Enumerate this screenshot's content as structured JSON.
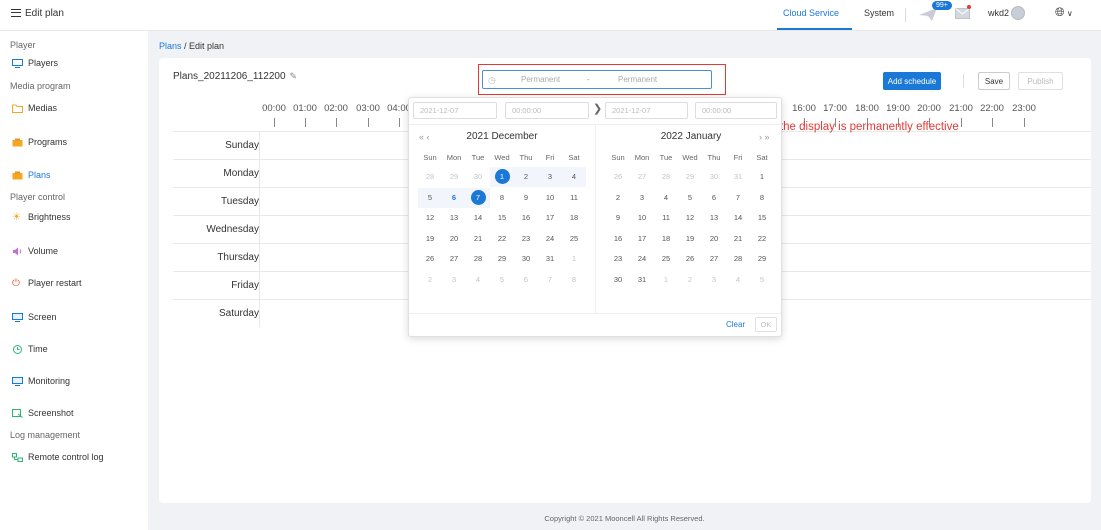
{
  "topbar": {
    "menu_label": "Edit plan",
    "nav": [
      "Cloud Service",
      "System"
    ],
    "badge": "99+",
    "user": "wkd2"
  },
  "sidebar": {
    "groups": [
      {
        "heading": "Player",
        "items": [
          "Players"
        ]
      },
      {
        "heading": "Media program",
        "items": [
          "Medias",
          "Programs",
          "Plans"
        ]
      },
      {
        "heading": "Player control",
        "items": [
          "Brightness",
          "Volume",
          "Player restart",
          "Screen",
          "Time",
          "Monitoring",
          "Screenshot"
        ]
      },
      {
        "heading": "Log management",
        "items": [
          "Remote control log"
        ]
      }
    ],
    "active": "Plans"
  },
  "breadcrumb": {
    "parent": "Plans",
    "separator": " / ",
    "current": "Edit plan"
  },
  "plan": {
    "name": "Plans_20211206_112200",
    "range_start_placeholder": "Permanent",
    "range_separator": "-",
    "range_end_placeholder": "Permanent",
    "add_schedule": "Add schedule",
    "save": "Save",
    "publish": "Publish"
  },
  "timeline": {
    "ticks": [
      "00:00",
      "01:00",
      "02:00",
      "03:00",
      "04:00",
      "16:00",
      "17:00",
      "18:00",
      "19:00",
      "20:00",
      "21:00",
      "22:00",
      "23:00"
    ],
    "days": [
      "Sunday",
      "Monday",
      "Tuesday",
      "Wednesday",
      "Thursday",
      "Friday",
      "Saturday"
    ]
  },
  "annotation": "Set the effective time to display the time filter box, if not set, the display is permanently effective",
  "picker": {
    "start_date": "2021-12-07",
    "start_time": "00:00:00",
    "end_date": "2021-12-07",
    "end_time": "00:00:00",
    "nav_prev": "«  ‹",
    "nav_next": "›  »",
    "left_title": "2021 December",
    "right_title": "2022 January",
    "weekdays": [
      "Sun",
      "Mon",
      "Tue",
      "Wed",
      "Thu",
      "Fri",
      "Sat"
    ],
    "left_days": [
      [
        "28",
        "29",
        "30",
        "1",
        "2",
        "3",
        "4"
      ],
      [
        "5",
        "6",
        "7",
        "8",
        "9",
        "10",
        "11"
      ],
      [
        "12",
        "13",
        "14",
        "15",
        "16",
        "17",
        "18"
      ],
      [
        "19",
        "20",
        "21",
        "22",
        "23",
        "24",
        "25"
      ],
      [
        "26",
        "27",
        "28",
        "29",
        "30",
        "31",
        "1"
      ],
      [
        "2",
        "3",
        "4",
        "5",
        "6",
        "7",
        "8"
      ]
    ],
    "right_days": [
      [
        "26",
        "27",
        "28",
        "29",
        "30",
        "31",
        "1"
      ],
      [
        "2",
        "3",
        "4",
        "5",
        "6",
        "7",
        "8"
      ],
      [
        "9",
        "10",
        "11",
        "12",
        "13",
        "14",
        "15"
      ],
      [
        "16",
        "17",
        "18",
        "19",
        "20",
        "21",
        "22"
      ],
      [
        "23",
        "24",
        "25",
        "26",
        "27",
        "28",
        "29"
      ],
      [
        "30",
        "31",
        "1",
        "2",
        "3",
        "4",
        "5"
      ]
    ],
    "clear": "Clear",
    "ok": "OK"
  },
  "footer": "Copyright © 2021 Mooncell All Rights Reserved.",
  "colors": {
    "primary": "#1a78d6",
    "annotation": "#e53935"
  }
}
